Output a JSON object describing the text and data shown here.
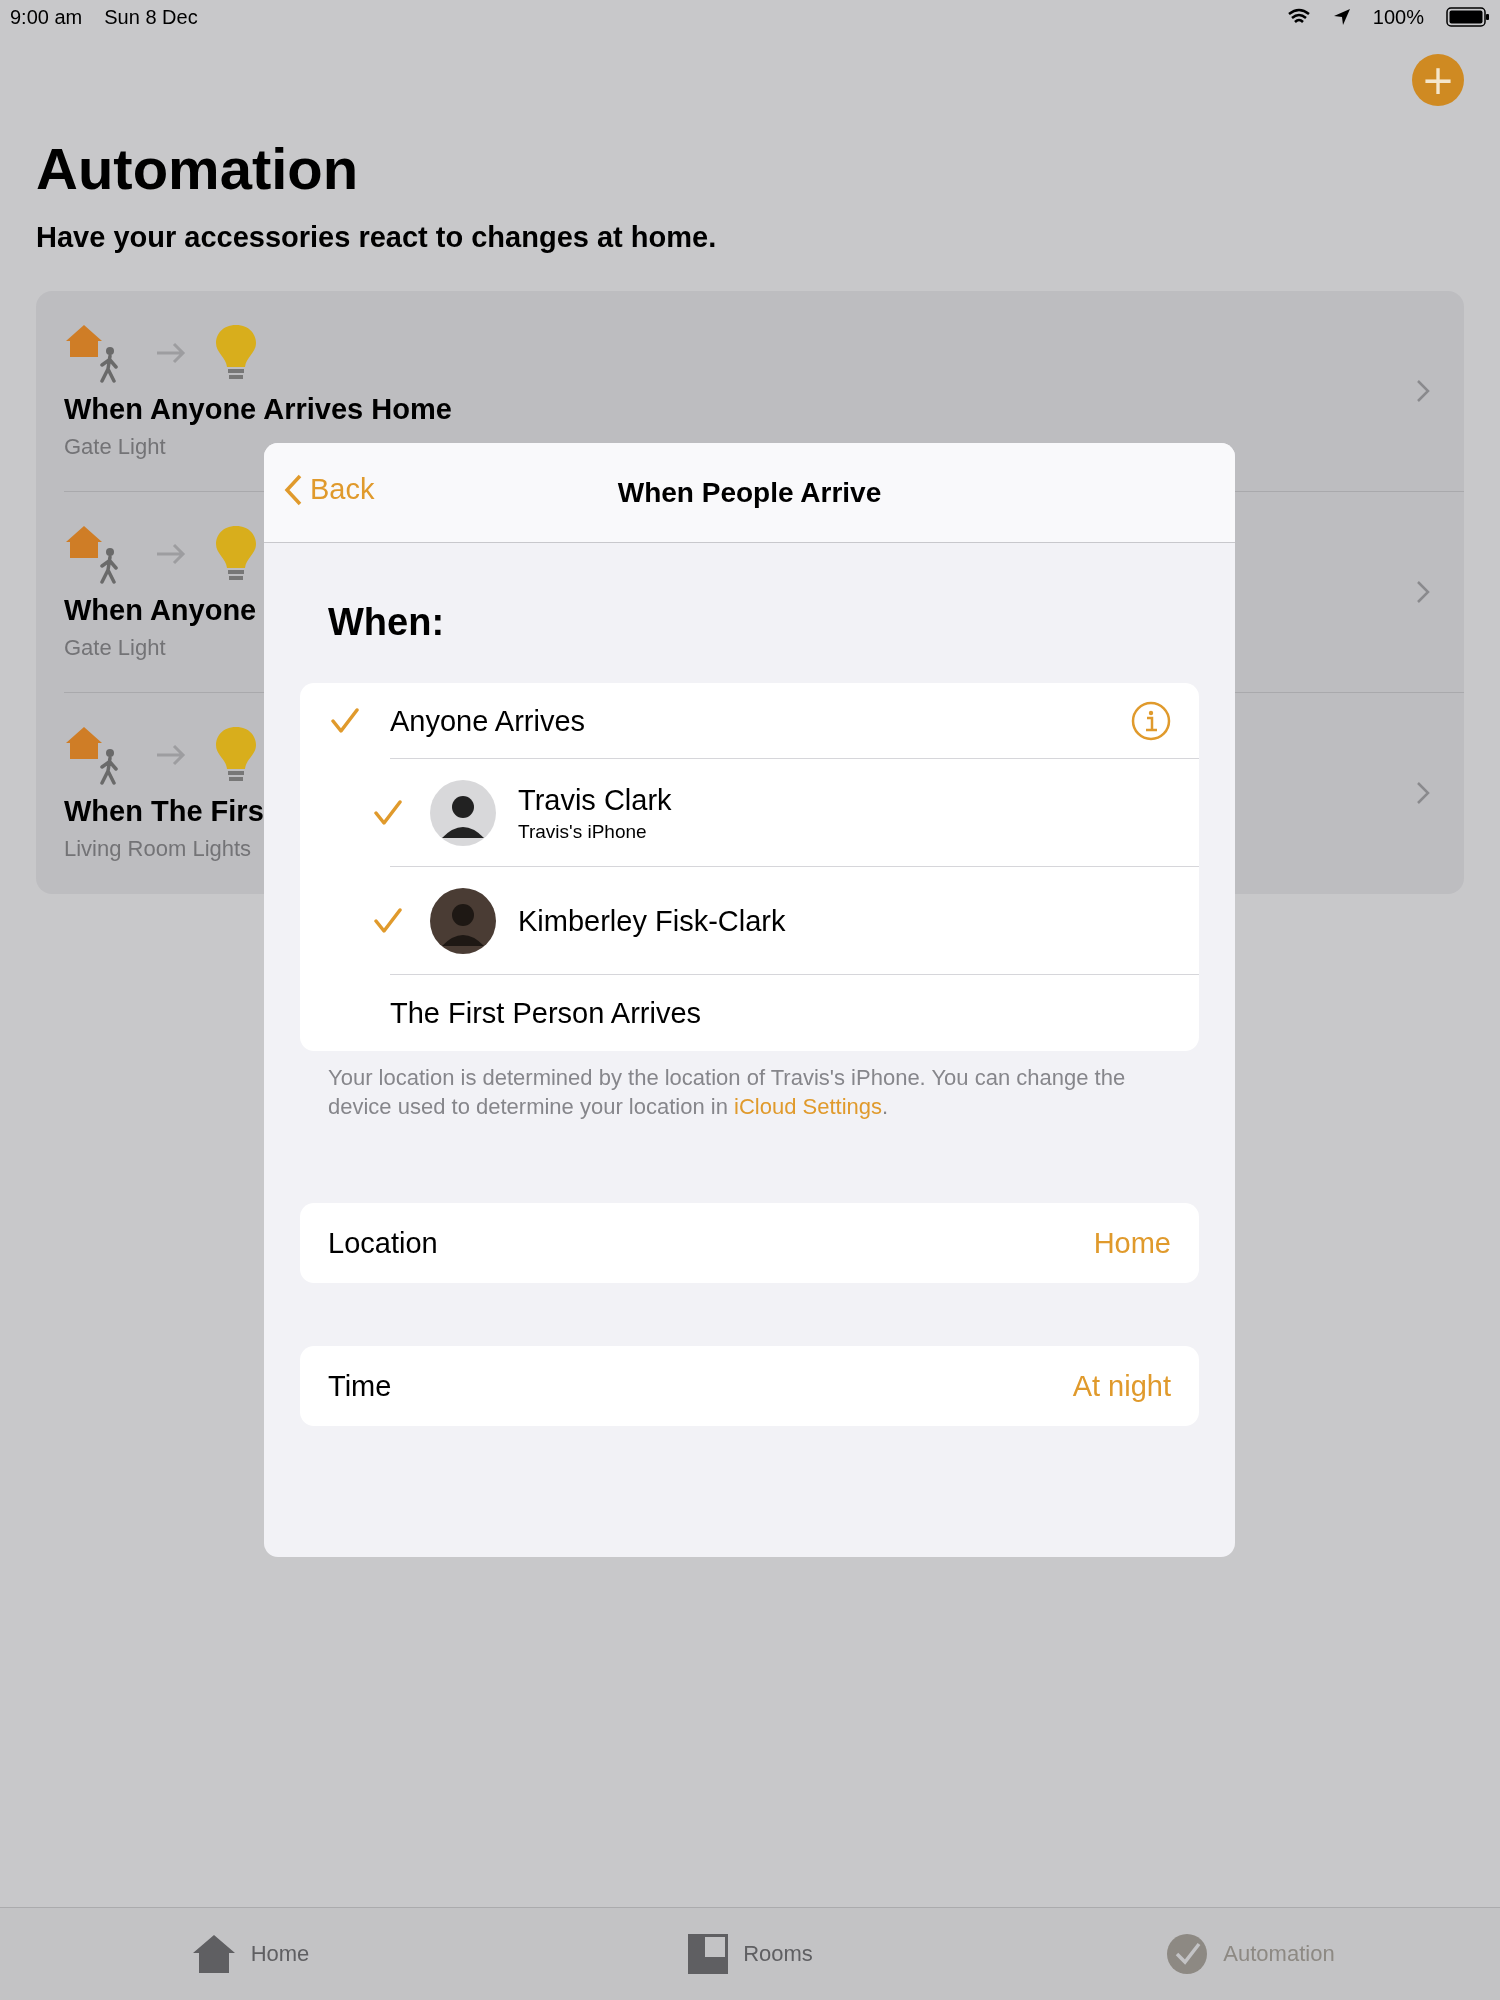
{
  "status_bar": {
    "time": "9:00 am",
    "date": "Sun 8 Dec",
    "battery": "100%"
  },
  "add_button": {
    "label": "+"
  },
  "header": {
    "title": "Automation",
    "subtitle": "Have your accessories react to changes at home."
  },
  "automations": [
    {
      "title": "When Anyone Arrives Home",
      "subtitle": "Gate Light"
    },
    {
      "title": "When Anyone",
      "subtitle": "Gate Light"
    },
    {
      "title": "When The Firs",
      "subtitle": "Living Room Lights"
    }
  ],
  "dialog": {
    "back": "Back",
    "title": "When People Arrive",
    "section": "When:",
    "options": [
      {
        "kind": "option",
        "label": "Anyone Arrives",
        "checked": true,
        "info": true
      },
      {
        "kind": "person",
        "label": "Travis Clark",
        "detail": "Travis's iPhone",
        "checked": true
      },
      {
        "kind": "person",
        "label": "Kimberley Fisk-Clark",
        "checked": true
      },
      {
        "kind": "option",
        "label": "The First Person Arrives",
        "checked": false
      }
    ],
    "note": "Your location is determined by the location of Travis's iPhone. You can change the device used to determine your location in ",
    "note_link": "iCloud Settings",
    "note_end": ".",
    "settings": [
      {
        "label": "Location",
        "value": "Home"
      },
      {
        "label": "Time",
        "value": "At night"
      }
    ]
  },
  "tabs": [
    {
      "label": "Home",
      "selected": false
    },
    {
      "label": "Rooms",
      "selected": false
    },
    {
      "label": "Automation",
      "selected": true
    }
  ]
}
